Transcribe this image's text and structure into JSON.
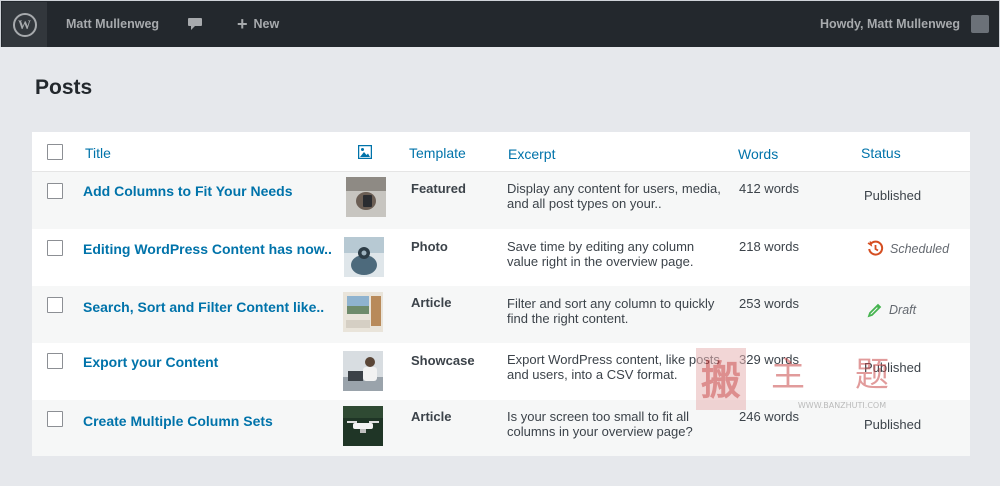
{
  "adminbar": {
    "user_name": "Matt Mullenweg",
    "new_label": "New",
    "howdy_label": "Howdy,  Matt Mullenweg",
    "icons": {
      "logo": "wordpress-logo-icon",
      "comments": "comment-bubble-icon",
      "add": "plus-icon"
    }
  },
  "page": {
    "title": "Posts"
  },
  "table": {
    "headers": {
      "title": "Title",
      "featured_image_icon": "image-icon",
      "template": "Template",
      "excerpt": "Excerpt",
      "words": "Words",
      "status": "Status"
    },
    "rows": [
      {
        "title": "Add Columns to Fit Your Needs",
        "template": "Featured",
        "excerpt": "Display any content for users, media, and all post types on your..",
        "words": "412 words",
        "status": "Published",
        "status_icon": ""
      },
      {
        "title": "Editing WordPress Content has now..",
        "template": "Photo",
        "excerpt": "Save time by editing any column value right in the overview page.",
        "words": "218 words",
        "status": "Scheduled",
        "status_icon": "clock-icon"
      },
      {
        "title": "Search, Sort and Filter Content like..",
        "template": "Article",
        "excerpt": "Filter and sort any column to quickly find the right content.",
        "words": "253 words",
        "status": "Draft",
        "status_icon": "pencil-icon"
      },
      {
        "title": "Export your Content",
        "template": "Showcase",
        "excerpt": "Export WordPress content, like posts and users, into a CSV format.",
        "words": "329 words",
        "status": "Published",
        "status_icon": ""
      },
      {
        "title": "Create Multiple Column Sets",
        "template": "Article",
        "excerpt": "Is your screen too small to fit all columns in your overview page?",
        "words": "246 words",
        "status": "Published",
        "status_icon": ""
      }
    ]
  },
  "colors": {
    "link": "#0073aa",
    "adminbar": "#23282d",
    "scheduled": "#d54e21",
    "draft": "#46b450"
  },
  "watermark": {
    "chars": "搬主题",
    "url": "WWW.BANZHUTI.COM"
  }
}
